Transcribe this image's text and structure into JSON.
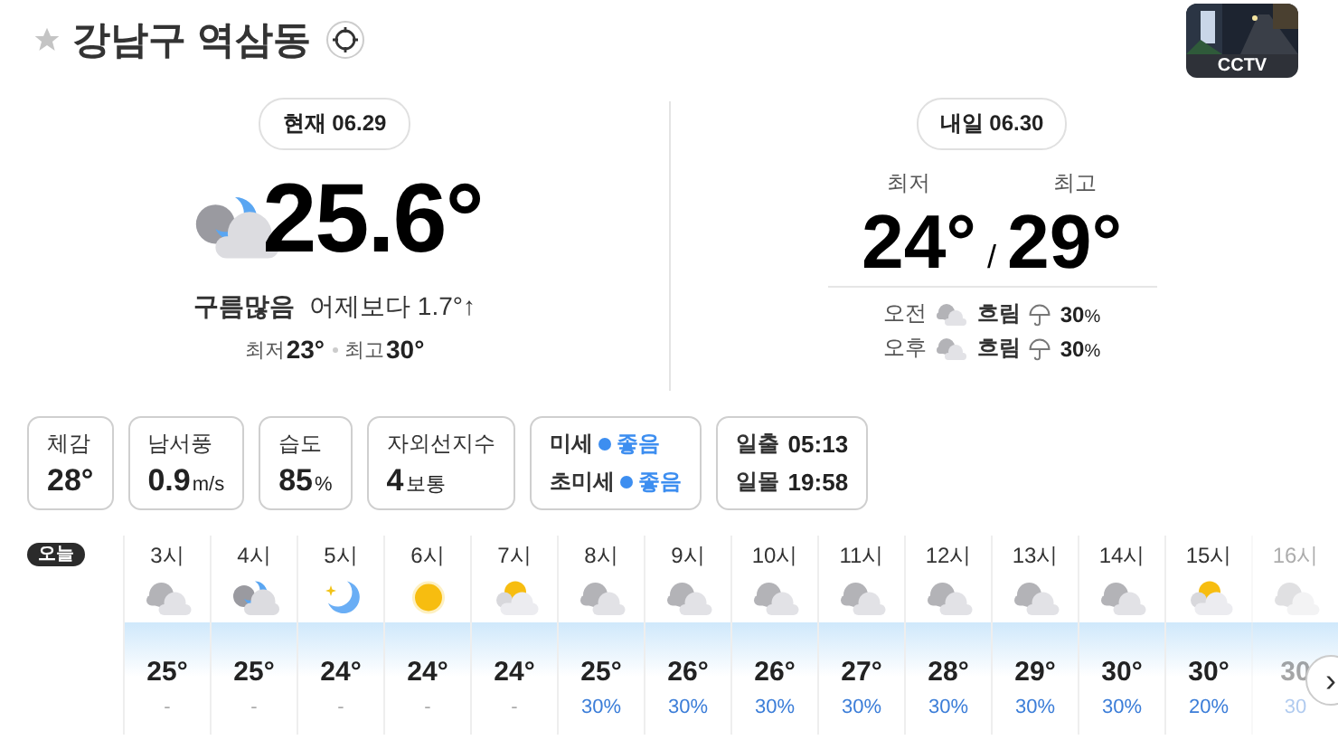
{
  "location": {
    "name": "강남구 역삼동",
    "favorite": false
  },
  "cctv": {
    "label": "CCTV"
  },
  "today": {
    "date_label": "현재 06.29",
    "kind": "moon-cloud",
    "temperature": "25.6°",
    "condition": "구름많음",
    "compare": "어제보다 1.7°↑",
    "min_label": "최저",
    "min": "23°",
    "max_label": "최고",
    "max": "30°"
  },
  "tomorrow": {
    "date_label": "내일 06.30",
    "min_label": "최저",
    "max_label": "최고",
    "min": "24°",
    "separator": "/",
    "max": "29°",
    "periods": [
      {
        "label": "오전",
        "kind": "cloudy",
        "condition": "흐림",
        "rain": "30",
        "unit": "%"
      },
      {
        "label": "오후",
        "kind": "cloudy",
        "condition": "흐림",
        "rain": "30",
        "unit": "%"
      }
    ]
  },
  "cards": [
    {
      "kind": "simple",
      "label": "체감",
      "value": "28°"
    },
    {
      "kind": "simple",
      "label": "남서풍",
      "value": "0.9",
      "unit": "m/s"
    },
    {
      "kind": "simple",
      "label": "습도",
      "value": "85",
      "unit": "%"
    },
    {
      "kind": "simple",
      "label": "자외선지수",
      "value": "4",
      "unit": "보통"
    },
    {
      "kind": "dust",
      "rows": [
        {
          "label": "미세",
          "status": "좋음",
          "color": "#3d8ef0"
        },
        {
          "label": "초미세",
          "status": "좋음",
          "color": "#3d8ef0"
        }
      ]
    },
    {
      "kind": "sun",
      "rows": [
        {
          "label": "일출",
          "time": "05:13"
        },
        {
          "label": "일몰",
          "time": "19:58"
        }
      ]
    }
  ],
  "hourly": {
    "day_label": "오늘",
    "next_button": "›",
    "hours": [
      {
        "time": "3시",
        "kind": "cloudy",
        "temp": "25°",
        "rain": "-"
      },
      {
        "time": "4시",
        "kind": "moon-cloud",
        "temp": "25°",
        "rain": "-"
      },
      {
        "time": "5시",
        "kind": "moon",
        "temp": "24°",
        "rain": "-"
      },
      {
        "time": "6시",
        "kind": "sun",
        "temp": "24°",
        "rain": "-"
      },
      {
        "time": "7시",
        "kind": "sun-cloud",
        "temp": "24°",
        "rain": "-"
      },
      {
        "time": "8시",
        "kind": "cloudy",
        "temp": "25°",
        "rain": "30%"
      },
      {
        "time": "9시",
        "kind": "cloudy",
        "temp": "26°",
        "rain": "30%"
      },
      {
        "time": "10시",
        "kind": "cloudy",
        "temp": "26°",
        "rain": "30%"
      },
      {
        "time": "11시",
        "kind": "cloudy",
        "temp": "27°",
        "rain": "30%"
      },
      {
        "time": "12시",
        "kind": "cloudy",
        "temp": "28°",
        "rain": "30%"
      },
      {
        "time": "13시",
        "kind": "cloudy",
        "temp": "29°",
        "rain": "30%"
      },
      {
        "time": "14시",
        "kind": "cloudy",
        "temp": "30°",
        "rain": "30%"
      },
      {
        "time": "15시",
        "kind": "sun-cloud",
        "temp": "30°",
        "rain": "20%"
      },
      {
        "time": "16시",
        "kind": "cloudy",
        "temp": "30",
        "rain": "30",
        "faded": true
      }
    ]
  }
}
